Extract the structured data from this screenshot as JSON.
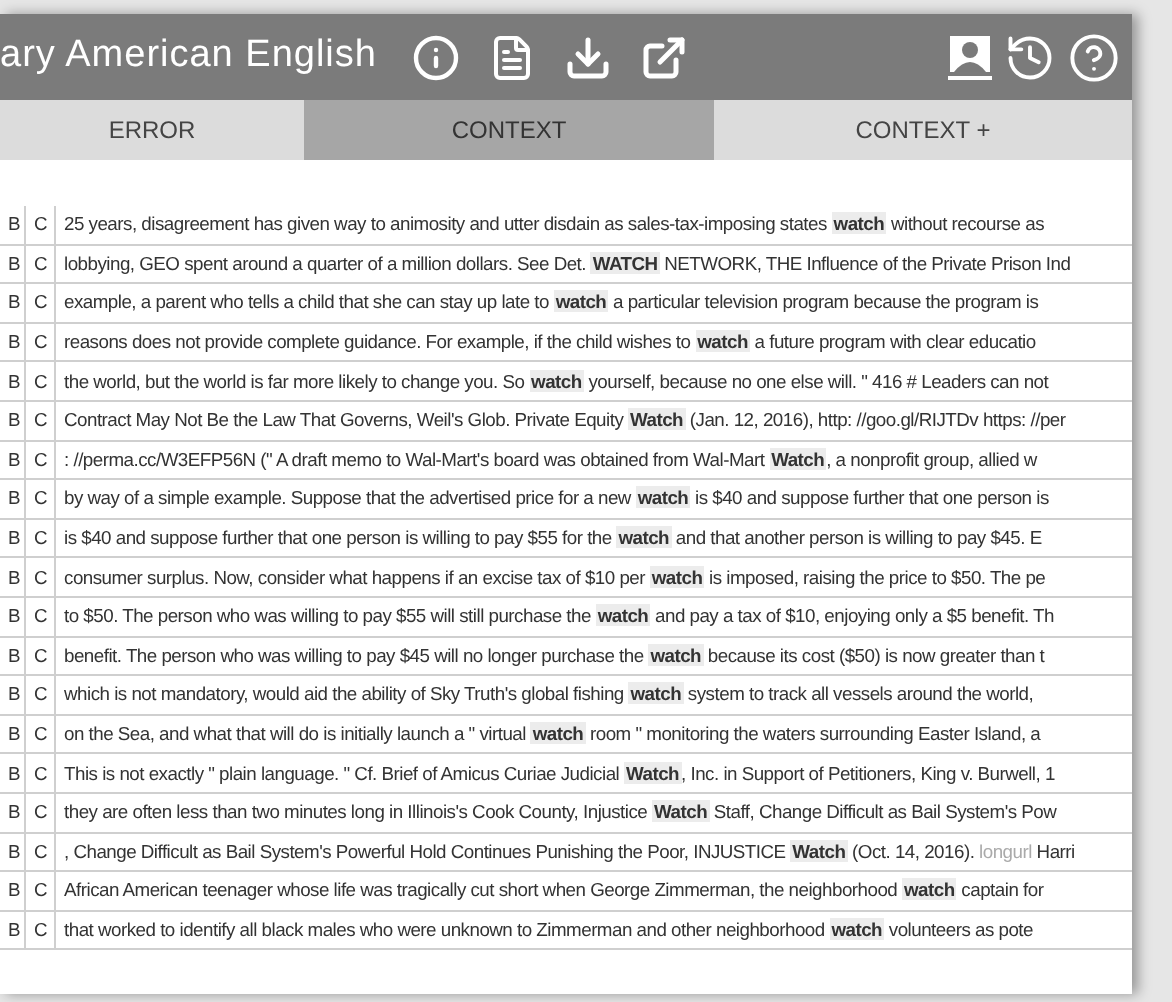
{
  "header": {
    "title": "ary American English"
  },
  "tabs": [
    {
      "label": "ERROR",
      "selected": false
    },
    {
      "label": "CONTEXT",
      "selected": true
    },
    {
      "label": "CONTEXT +",
      "selected": false
    }
  ],
  "rows": [
    {
      "b": "B",
      "c": "C",
      "before": "25 years, disagreement has given way to animosity and utter disdain as sales-tax-imposing states ",
      "keyword": "watch",
      "after": " without recourse as"
    },
    {
      "b": "B",
      "c": "C",
      "before": "lobbying, GEO spent around a quarter of a million dollars. See Det. ",
      "keyword": "WATCH",
      "after": " NETWORK, THE Influence of the Private Prison Ind"
    },
    {
      "b": "B",
      "c": "C",
      "before": "example, a parent who tells a child that she can stay up late to ",
      "keyword": "watch",
      "after": " a particular television program because the program is"
    },
    {
      "b": "B",
      "c": "C",
      "before": "reasons does not provide complete guidance. For example, if the child wishes to ",
      "keyword": "watch",
      "after": " a future program with clear educatio"
    },
    {
      "b": "B",
      "c": "C",
      "before": "the world, but the world is far more likely to change you. So ",
      "keyword": "watch",
      "after": " yourself, because no one else will. \" 416 # Leaders can not"
    },
    {
      "b": "B",
      "c": "C",
      "before": "Contract May Not Be the Law That Governs, Weil's Glob. Private Equity ",
      "keyword": "Watch",
      "after": " (Jan. 12, 2016), http: //goo.gl/RIJTDv https: //per"
    },
    {
      "b": "B",
      "c": "C",
      "before": ": //perma.cc/W3EFP56N (\" A draft memo to Wal-Mart's board was obtained from Wal-Mart ",
      "keyword": "Watch",
      "after": ", a nonprofit group, allied w"
    },
    {
      "b": "B",
      "c": "C",
      "before": "by way of a simple example. Suppose that the advertised price for a new ",
      "keyword": "watch",
      "after": " is $40 and suppose further that one person is"
    },
    {
      "b": "B",
      "c": "C",
      "before": "is $40 and suppose further that one person is willing to pay $55 for the ",
      "keyword": "watch",
      "after": " and that another person is willing to pay $45. E"
    },
    {
      "b": "B",
      "c": "C",
      "before": "consumer surplus. Now, consider what happens if an excise tax of $10 per ",
      "keyword": "watch",
      "after": " is imposed, raising the price to $50. The pe"
    },
    {
      "b": "B",
      "c": "C",
      "before": "to $50. The person who was willing to pay $55 will still purchase the ",
      "keyword": "watch",
      "after": " and pay a tax of $10, enjoying only a $5 benefit. Th"
    },
    {
      "b": "B",
      "c": "C",
      "before": "benefit. The person who was willing to pay $45 will no longer purchase the ",
      "keyword": "watch",
      "after": " because its cost ($50) is now greater than t"
    },
    {
      "b": "B",
      "c": "C",
      "before": "which is not mandatory, would aid the ability of Sky Truth's global fishing ",
      "keyword": "watch",
      "after": " system to track all vessels around the world,"
    },
    {
      "b": "B",
      "c": "C",
      "before": "on the Sea, and what that will do is initially launch a \" virtual ",
      "keyword": "watch",
      "after": " room \" monitoring the waters surrounding Easter Island, a"
    },
    {
      "b": "B",
      "c": "C",
      "before": "This is not exactly \" plain language. \" Cf. Brief of Amicus Curiae Judicial ",
      "keyword": "Watch",
      "after": ", Inc. in Support of Petitioners, King v. Burwell, 1"
    },
    {
      "b": "B",
      "c": "C",
      "before": "they are often less than two minutes long in Illinois's Cook County, Injustice ",
      "keyword": "Watch",
      "after": " Staff, Change Difficult as Bail System's Pow"
    },
    {
      "b": "B",
      "c": "C",
      "before": ", Change Difficult as Bail System's Powerful Hold Continues Punishing the Poor, INJUSTICE ",
      "keyword": "Watch",
      "after": " (Oct. 14, 2016). ",
      "faded": "longurl",
      "tail": " Harri"
    },
    {
      "b": "B",
      "c": "C",
      "before": "African American teenager whose life was tragically cut short when George Zimmerman, the neighborhood ",
      "keyword": "watch",
      "after": " captain for"
    },
    {
      "b": "B",
      "c": "C",
      "before": "that worked to identify all black males who were unknown to Zimmerman and other neighborhood ",
      "keyword": "watch",
      "after": " volunteers as pote"
    }
  ]
}
